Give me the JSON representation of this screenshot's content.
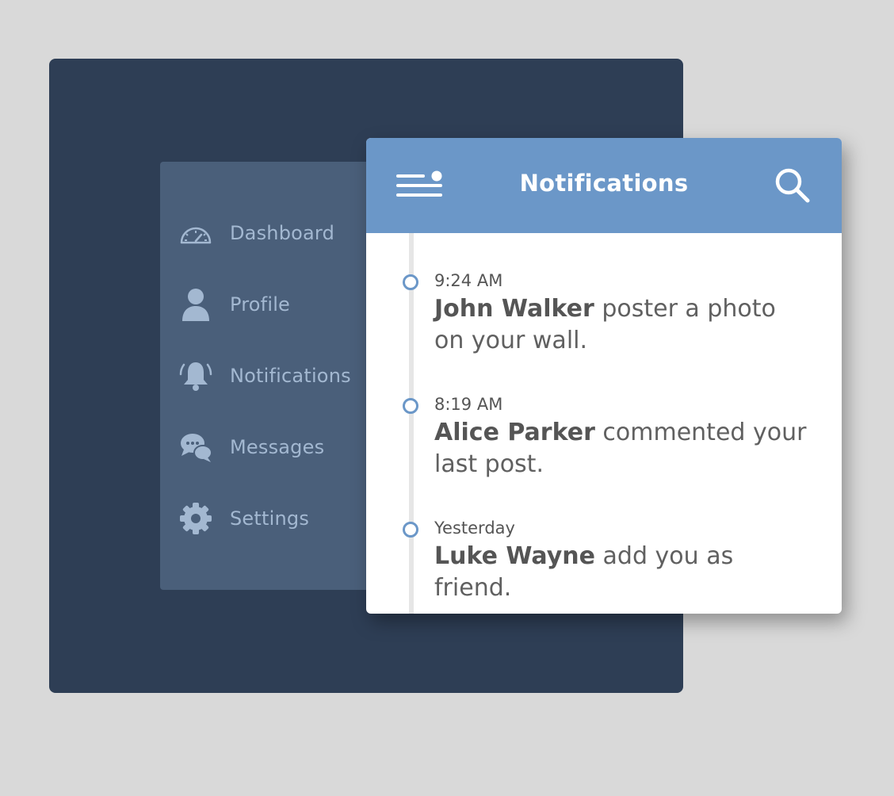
{
  "colors": {
    "background": "#d9d9d9",
    "dark_panel": "#2e3e55",
    "sidebar": "#4a5f7a",
    "sidebar_text": "#a3b8d1",
    "header": "#6b97c8",
    "card": "#ffffff"
  },
  "sidebar": {
    "items": [
      {
        "label": "Dashboard",
        "icon": "speedometer-icon"
      },
      {
        "label": "Profile",
        "icon": "user-icon"
      },
      {
        "label": "Notifications",
        "icon": "bell-icon"
      },
      {
        "label": "Messages",
        "icon": "chat-bubbles-icon"
      },
      {
        "label": "Settings",
        "icon": "gear-icon"
      }
    ]
  },
  "notifications": {
    "title": "Notifications",
    "menu_icon": "menu-icon",
    "search_icon": "search-icon",
    "items": [
      {
        "time": "9:24 AM",
        "name": "John Walker",
        "text": " poster a photo on your wall."
      },
      {
        "time": "8:19 AM",
        "name": "Alice Parker",
        "text": " commented your last post."
      },
      {
        "time": "Yesterday",
        "name": "Luke Wayne",
        "text": " add you as friend."
      }
    ]
  }
}
